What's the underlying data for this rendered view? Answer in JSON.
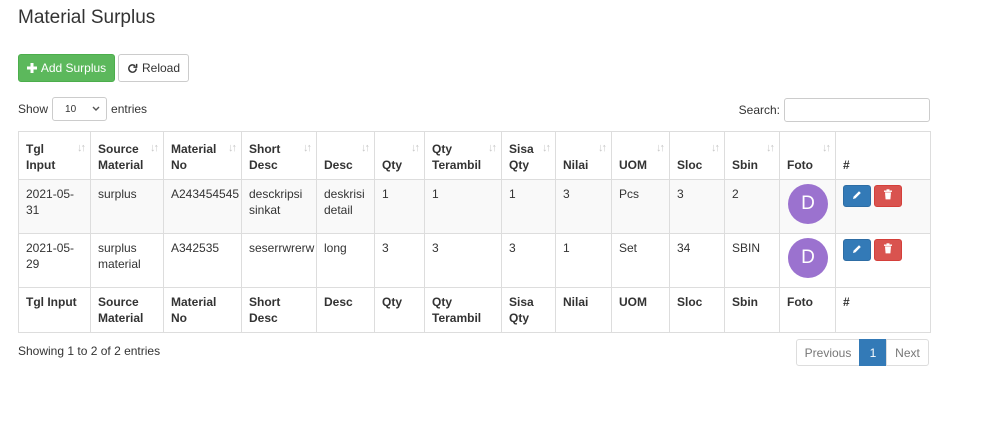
{
  "page": {
    "title": "Material Surplus"
  },
  "toolbar": {
    "add_label": "Add Surplus",
    "reload_label": "Reload"
  },
  "length": {
    "prefix": "Show",
    "value": "10",
    "suffix": "entries"
  },
  "search": {
    "label": "Search:",
    "value": ""
  },
  "columns": [
    "Tgl Input",
    "Source Material",
    "Material No",
    "Short Desc",
    "Desc",
    "Qty",
    "Qty Terambil",
    "Sisa Qty",
    "Nilai",
    "UOM",
    "Sloc",
    "Sbin",
    "Foto",
    "#"
  ],
  "rows": [
    {
      "tgl_input": "2021-05-31",
      "source_material": "surplus",
      "material_no": "A243454545",
      "short_desc": "desckripsi sinkat",
      "desc": "deskrisi detail",
      "qty": "1",
      "qty_terambil": "1",
      "sisa_qty": "1",
      "nilai": "3",
      "uom": "Pcs",
      "sloc": "3",
      "sbin": "2",
      "foto": "D"
    },
    {
      "tgl_input": "2021-05-29",
      "source_material": "surplus material",
      "material_no": "A342535",
      "short_desc": "seserrwrerw",
      "desc": "long",
      "qty": "3",
      "qty_terambil": "3",
      "sisa_qty": "3",
      "nilai": "1",
      "uom": "Set",
      "sloc": "34",
      "sbin": "SBIN",
      "foto": "D"
    }
  ],
  "info": "Showing 1 to 2 of 2 entries",
  "pagination": {
    "previous": "Previous",
    "current": "1",
    "next": "Next"
  },
  "colors": {
    "add": "#5cb85c",
    "primary": "#337ab7",
    "danger": "#d9534f",
    "avatar": "#9b72cf"
  },
  "icons": {
    "add": "plus-icon",
    "reload": "refresh-icon",
    "edit": "pencil-icon",
    "delete": "trash-icon",
    "sort": "sort-icon",
    "select": "chevron-down-icon"
  }
}
